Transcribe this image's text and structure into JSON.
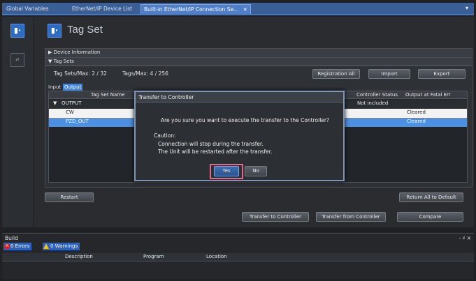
{
  "tabs": [
    {
      "label": "Global Variables"
    },
    {
      "label": "EtherNet/IP Device List"
    },
    {
      "label": "Built-in EtherNet/IP Connection Se..."
    }
  ],
  "page_title": "Tag Set",
  "sections": {
    "device_information": "▶ Device Information",
    "tag_sets": "▼ Tag Sets"
  },
  "tagsets": {
    "count_text": "Tag Sets/Max:  2  /  32",
    "tags_text": "Tags/Max:  4  /  256",
    "registration_all": "Registration All",
    "import": "Import",
    "export": "Export",
    "input_label": "Input",
    "output_label": "Output"
  },
  "table": {
    "columns": [
      "Tag Set Name",
      "Controller Status",
      "Output at Fatal Err"
    ],
    "rows": [
      {
        "toggle": "▼",
        "name": "OUTPUT",
        "controller_status": "Not included",
        "output_fatal": ""
      },
      {
        "toggle": "",
        "name": "CW",
        "controller_status": "",
        "output_fatal": "Cleared"
      },
      {
        "toggle": "",
        "name": "PZD_OUT",
        "controller_status": "",
        "output_fatal": "Cleared"
      }
    ]
  },
  "dialog": {
    "title": "Transfer to Controller",
    "question": "Are you sure you want to execute the transfer to the Controller?",
    "caution_label": "Caution:",
    "caution_line1": "Connection will stop during the transfer.",
    "caution_line2": "The Unit will be restarted after the transfer.",
    "yes": "Yes",
    "no": "No"
  },
  "actions": {
    "restart": "Restart",
    "return_all_default": "Return All to Default",
    "transfer_to": "Transfer to Controller",
    "transfer_from": "Transfer from Controller",
    "compare": "Compare"
  },
  "build": {
    "title": "Build",
    "controls": "- ♯ ×",
    "errors": "0 Errors",
    "warnings": "0 Warnings",
    "columns": [
      "Description",
      "Program",
      "Location"
    ]
  },
  "colors": {
    "accent": "#2e6cc3",
    "dialog_highlight": "#e06a8a",
    "selected_row": "#4d8fe0"
  }
}
